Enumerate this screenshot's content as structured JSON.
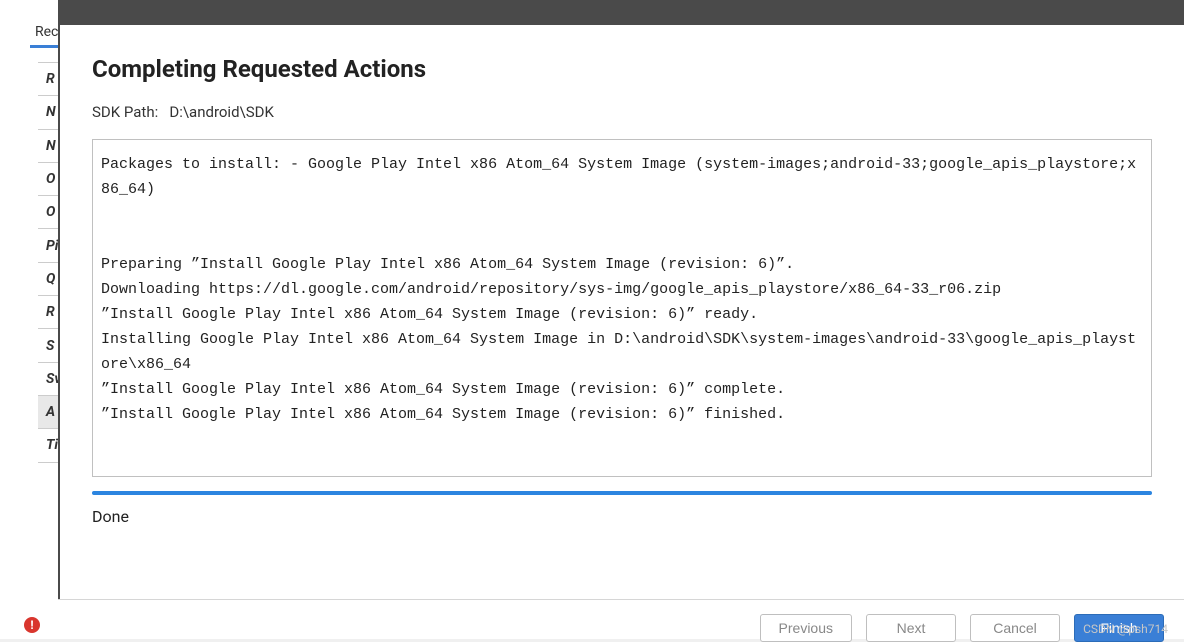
{
  "background": {
    "tab_label": "Rec",
    "rows": [
      "R",
      "N",
      "N",
      "O",
      "O",
      "Pi",
      "Q",
      "R",
      "S",
      "Sv",
      "A",
      "Ti"
    ],
    "error_icon": "!"
  },
  "modal": {
    "heading": "Completing Requested Actions",
    "sdk_path_label": "SDK Path:",
    "sdk_path_value": "D:\\android\\SDK",
    "log_text": "Packages to install: - Google Play Intel x86 Atom_64 System Image (system-images;android-33;google_apis_playstore;x86_64)\n\n\nPreparing ”Install Google Play Intel x86 Atom_64 System Image (revision: 6)”.\nDownloading https://dl.google.com/android/repository/sys-img/google_apis_playstore/x86_64-33_r06.zip\n”Install Google Play Intel x86 Atom_64 System Image (revision: 6)” ready.\nInstalling Google Play Intel x86 Atom_64 System Image in D:\\android\\SDK\\system-images\\android-33\\google_apis_playstore\\x86_64\n”Install Google Play Intel x86 Atom_64 System Image (revision: 6)” complete.\n”Install Google Play Intel x86 Atom_64 System Image (revision: 6)” finished.",
    "status_text": "Done",
    "buttons": {
      "previous": "Previous",
      "next": "Next",
      "cancel": "Cancel",
      "finish": "Finish"
    }
  },
  "watermark": "CSDN @psh714"
}
